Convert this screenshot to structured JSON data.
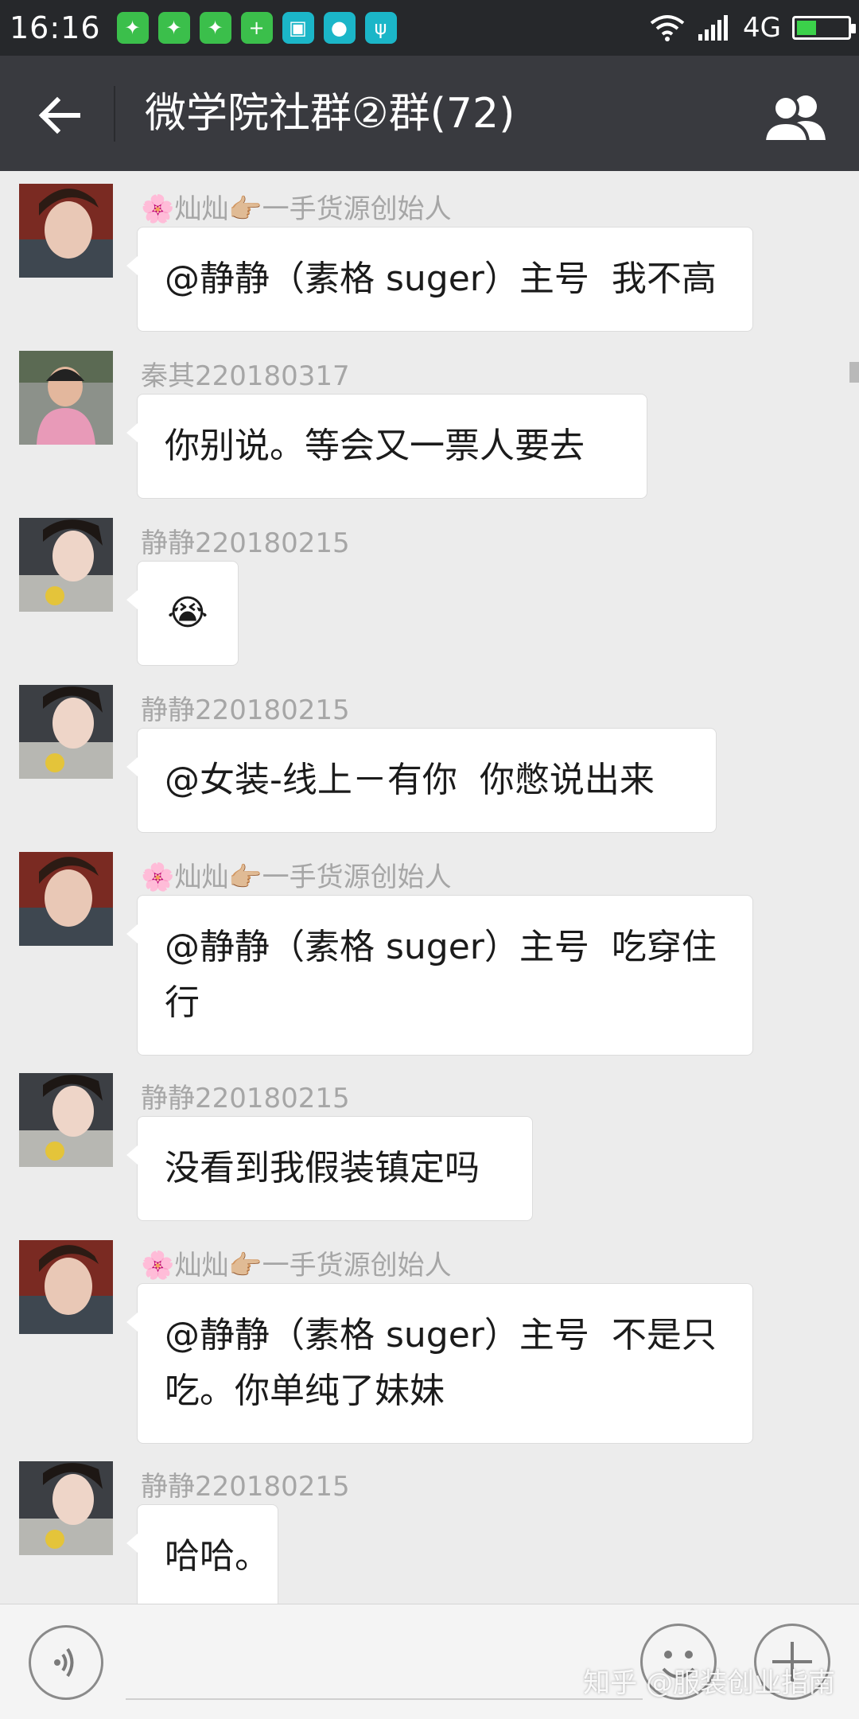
{
  "status_bar": {
    "time": "16:16",
    "network": "4G",
    "notification_icons": [
      "wechat-icon",
      "wechat-icon",
      "wechat-icon",
      "health-icon",
      "scan-icon",
      "basketball-icon",
      "usb-icon"
    ],
    "battery_level": 0.35
  },
  "header": {
    "title": "微学院社群②群(72)"
  },
  "messages": [
    {
      "sender": "🌸灿灿👉🏼一手货源创始人",
      "lines": [
        "@静静（素格 suger）主号  我不高"
      ]
    },
    {
      "sender": "秦其220180317",
      "lines": [
        "你别说。等会又一票人要去"
      ]
    },
    {
      "sender": "静静220180215",
      "lines": [
        "😭"
      ]
    },
    {
      "sender": "静静220180215",
      "lines": [
        "@女装-线上－有你  你憋说出来"
      ]
    },
    {
      "sender": "🌸灿灿👉🏼一手货源创始人",
      "lines": [
        "@静静（素格 suger）主号  吃穿住",
        "行"
      ]
    },
    {
      "sender": "静静220180215",
      "lines": [
        "没看到我假装镇定吗"
      ]
    },
    {
      "sender": "🌸灿灿👉🏼一手货源创始人",
      "lines": [
        "@静静（素格 suger）主号  不是只",
        "吃。你单纯了妹妹"
      ]
    },
    {
      "sender": "静静220180215",
      "lines": [
        "哈哈。"
      ]
    }
  ],
  "watermark": "知乎 @服装创业指南",
  "colors": {
    "title_bar": "#393a3f",
    "status_bar": "#26282b",
    "chat_background": "#ececec",
    "bubble": "#ffffff"
  }
}
